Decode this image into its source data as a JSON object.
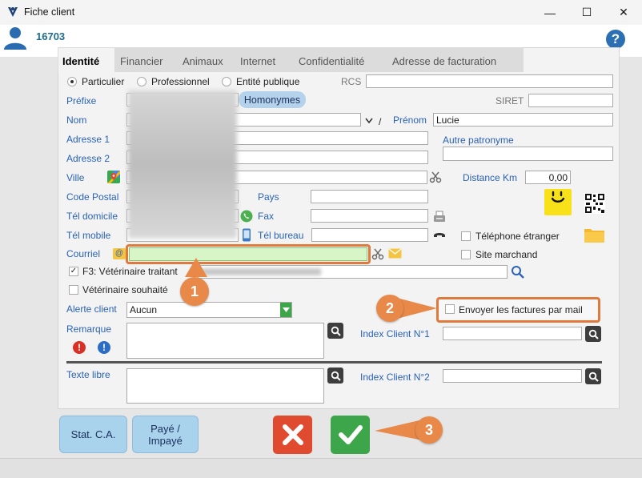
{
  "window": {
    "title": "Fiche client",
    "minimize": "—",
    "maximize": "☐",
    "close": "✕"
  },
  "client": {
    "number": "16703",
    "help": "?"
  },
  "tabs": [
    {
      "label": "Identité",
      "active": true
    },
    {
      "label": "Financier"
    },
    {
      "label": "Animaux"
    },
    {
      "label": "Internet"
    },
    {
      "label": "Confidentialité"
    },
    {
      "label": "Adresse de facturation"
    }
  ],
  "type": {
    "particulier": "Particulier",
    "professionnel": "Professionnel",
    "entite": "Entité publique",
    "selected": "particulier"
  },
  "labels": {
    "rcs": "RCS",
    "prefixe": "Préfixe",
    "homonymes": "Homonymes",
    "siret": "SIRET",
    "nom": "Nom",
    "slash": "/",
    "prenom": "Prénom",
    "adresse1": "Adresse 1",
    "adresse2": "Adresse 2",
    "autre_patronyme": "Autre patronyme",
    "ville": "Ville",
    "distance_km": "Distance Km",
    "code_postal": "Code Postal",
    "pays": "Pays",
    "tel_domicile": "Tél domicile",
    "fax": "Fax",
    "tel_mobile": "Tél mobile",
    "tel_bureau": "Tél bureau",
    "telephone_etranger": "Téléphone étranger",
    "courriel": "Courriel",
    "site_marchand": "Site marchand",
    "vet_traitant": "F3: Vétérinaire traitant",
    "vet_souhaite": "Vétérinaire souhaité",
    "alerte_client": "Alerte client",
    "envoyer_factures": "Envoyer les factures par mail",
    "remarque": "Remarque",
    "index1": "Index Client N°1",
    "texte_libre": "Texte libre",
    "index2": "Index Client N°2"
  },
  "values": {
    "prenom": "Lucie",
    "distance": "0,00",
    "alerte": "Aucun"
  },
  "buttons": {
    "stat": "Stat. C.A.",
    "paye": "Payé / Impayé"
  },
  "callouts": [
    "1",
    "2",
    "3"
  ],
  "colors": {
    "accent": "#2a62b6",
    "callout": "#e8894a",
    "ok": "#3da64a",
    "cancel": "#e04b30"
  }
}
